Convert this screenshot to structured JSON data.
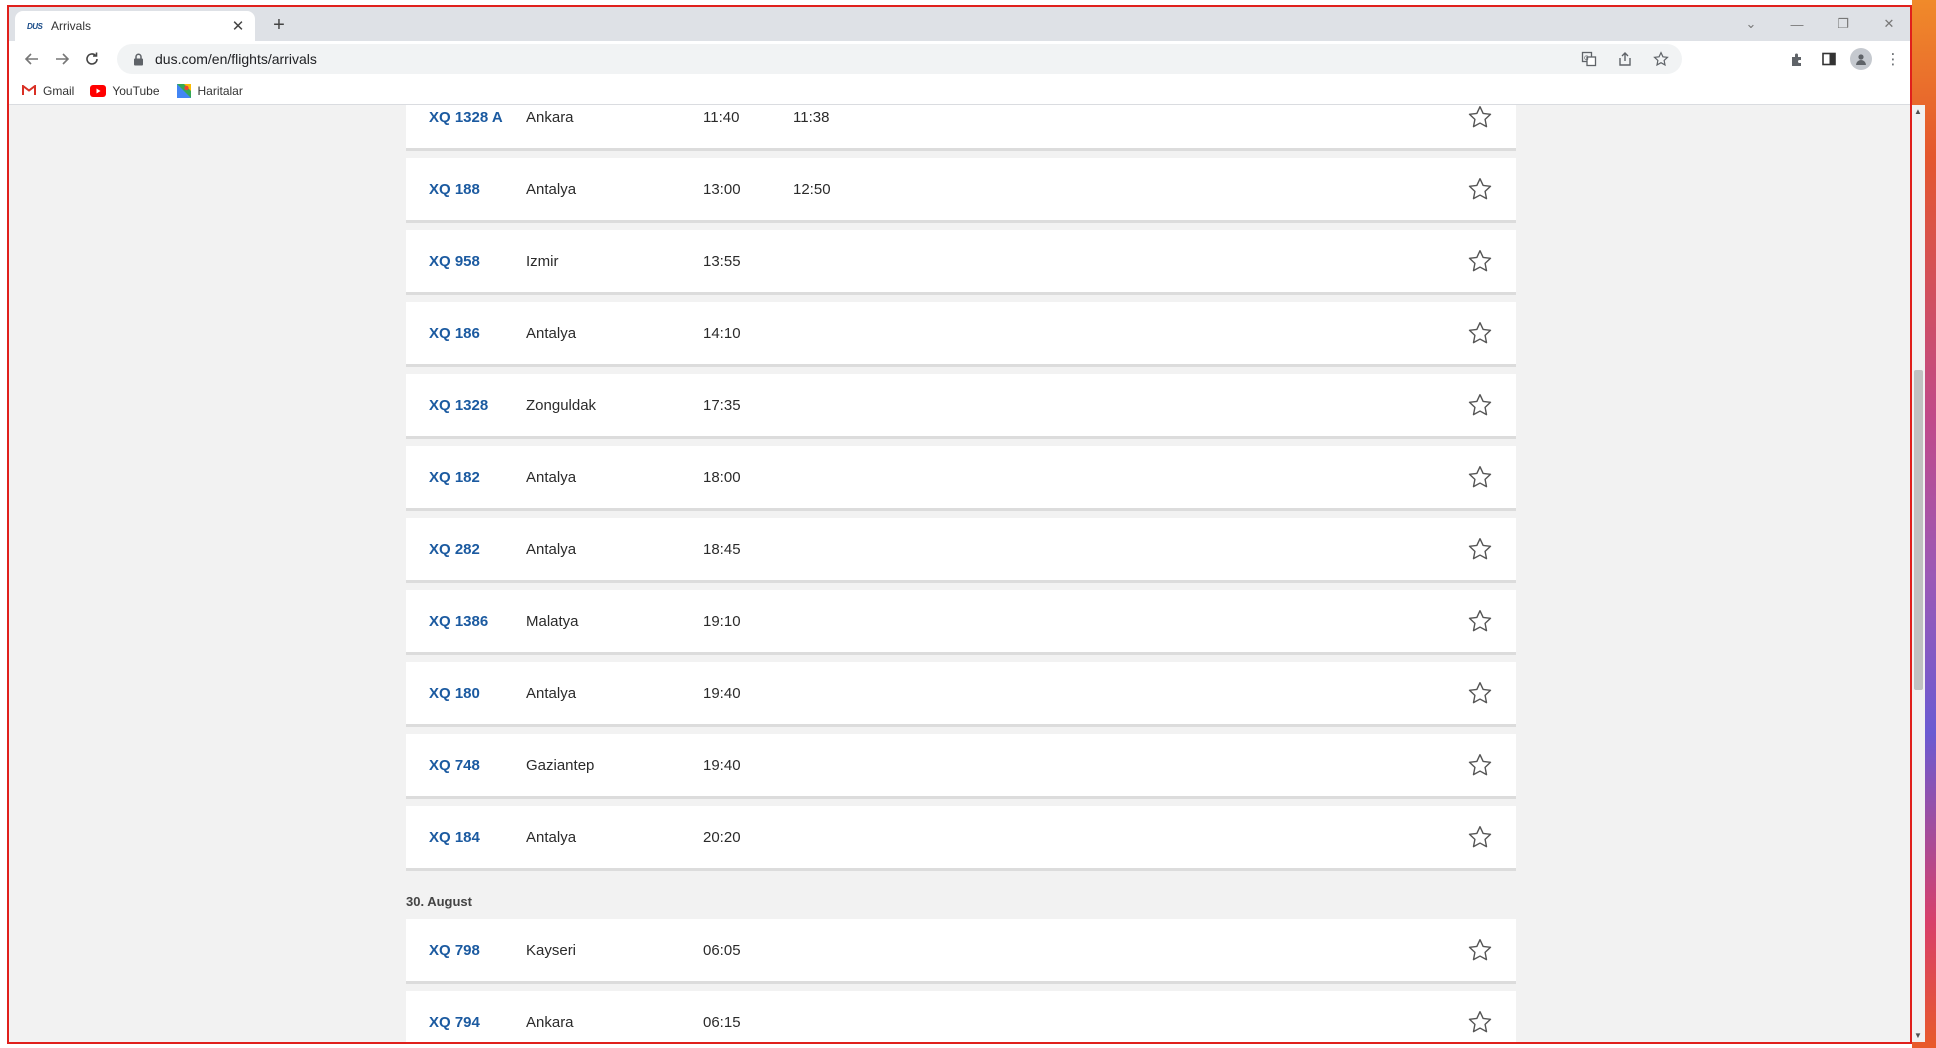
{
  "browser": {
    "tab_title": "Arrivals",
    "tab_favicon_text": "DUS",
    "url": "dus.com/en/flights/arrivals",
    "bookmarks": [
      {
        "label": "Gmail",
        "icon": "gmail-icon"
      },
      {
        "label": "YouTube",
        "icon": "youtube-icon"
      },
      {
        "label": "Haritalar",
        "icon": "maps-icon"
      }
    ]
  },
  "flights_day1": [
    {
      "flight": "XQ 1328 A",
      "city": "Ankara",
      "scheduled": "11:40",
      "actual": "11:38"
    },
    {
      "flight": "XQ 188",
      "city": "Antalya",
      "scheduled": "13:00",
      "actual": "12:50"
    },
    {
      "flight": "XQ 958",
      "city": "Izmir",
      "scheduled": "13:55",
      "actual": ""
    },
    {
      "flight": "XQ 186",
      "city": "Antalya",
      "scheduled": "14:10",
      "actual": ""
    },
    {
      "flight": "XQ 1328",
      "city": "Zonguldak",
      "scheduled": "17:35",
      "actual": ""
    },
    {
      "flight": "XQ 182",
      "city": "Antalya",
      "scheduled": "18:00",
      "actual": ""
    },
    {
      "flight": "XQ 282",
      "city": "Antalya",
      "scheduled": "18:45",
      "actual": ""
    },
    {
      "flight": "XQ 1386",
      "city": "Malatya",
      "scheduled": "19:10",
      "actual": ""
    },
    {
      "flight": "XQ 180",
      "city": "Antalya",
      "scheduled": "19:40",
      "actual": ""
    },
    {
      "flight": "XQ 748",
      "city": "Gaziantep",
      "scheduled": "19:40",
      "actual": ""
    },
    {
      "flight": "XQ 184",
      "city": "Antalya",
      "scheduled": "20:20",
      "actual": ""
    }
  ],
  "date_heading": "30. August",
  "flights_day2": [
    {
      "flight": "XQ 798",
      "city": "Kayseri",
      "scheduled": "06:05",
      "actual": ""
    },
    {
      "flight": "XQ 794",
      "city": "Ankara",
      "scheduled": "06:15",
      "actual": ""
    }
  ],
  "colors": {
    "flight_number": "#1b5aa0",
    "page_background": "#f2f2f2",
    "frame": "#e0201c"
  }
}
